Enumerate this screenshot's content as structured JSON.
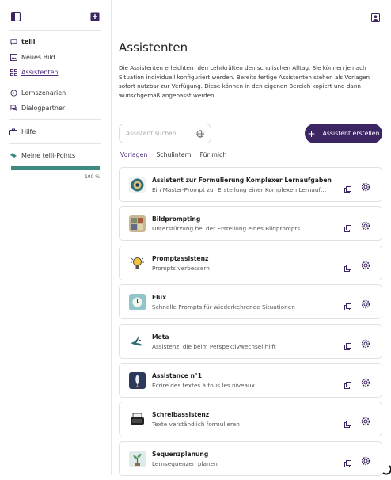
{
  "sidebar": {
    "items": [
      {
        "label": "telli",
        "icon": "chat-icon"
      },
      {
        "label": "Neues Bild",
        "icon": "image-icon"
      },
      {
        "label": "Assistenten",
        "icon": "grid-icon"
      },
      {
        "label": "Lernszenarien",
        "icon": "chat-bubble-icon"
      },
      {
        "label": "Dialogpartner",
        "icon": "dialog-icon"
      },
      {
        "label": "Hilfe",
        "icon": "help-icon"
      },
      {
        "label": "Meine telli-Points",
        "icon": "points-icon"
      }
    ],
    "points": {
      "label": "Meine telli-Points",
      "percent_text": "100 %",
      "fraction": 1.0
    }
  },
  "main": {
    "title": "Assistenten",
    "description": "Die Assistenten erleichtern den Lehrkräften den schulischen Alltag. Sie können je nach Situation individuell konfiguriert werden. Bereits fertige Assistenten stehen als Vorlagen sofort nutzbar zur Verfügung. Diese können in den eigenen Bereich kopiert und dann wunschgemäß angepasst werden.",
    "search_placeholder": "Assistent suchen...",
    "create_label": "Assistent erstellen",
    "tabs": [
      "Vorlagen",
      "Schulintern",
      "Für mich"
    ],
    "assistants": [
      {
        "title": "Assistent zur Formulierung Komplexer Lernaufgaben",
        "subtitle": "Ein Master-Prompt zur Erstellung einer Komplexen Lernaufgabe. ...",
        "icon": "mandala-icon"
      },
      {
        "title": "Bildprompting",
        "subtitle": "Unterstützung bei der Erstellung eines Bildprompts",
        "icon": "image-grid-icon"
      },
      {
        "title": "Promptassistenz",
        "subtitle": "Prompts verbessern",
        "icon": "lightbulb-icon"
      },
      {
        "title": "Flux",
        "subtitle": "Schnelle Prompts für wiederkehrende Situationen",
        "icon": "clock-icon"
      },
      {
        "title": "Meta",
        "subtitle": "Assistenz, die beim Perspektivwechsel hilft",
        "icon": "bird-icon"
      },
      {
        "title": "Assistance n°1",
        "subtitle": "Écrire des textes à tous les niveaux",
        "icon": "rocket-icon"
      },
      {
        "title": "Schreibassistenz",
        "subtitle": "Texte verständlich formulieren",
        "icon": "typewriter-icon"
      },
      {
        "title": "Sequenzplanung",
        "subtitle": "Lernsequenzen planen",
        "icon": "plant-icon"
      }
    ]
  },
  "colors": {
    "primary": "#3c2563",
    "progress": "#3d8a82",
    "link": "#4b2b7a"
  }
}
